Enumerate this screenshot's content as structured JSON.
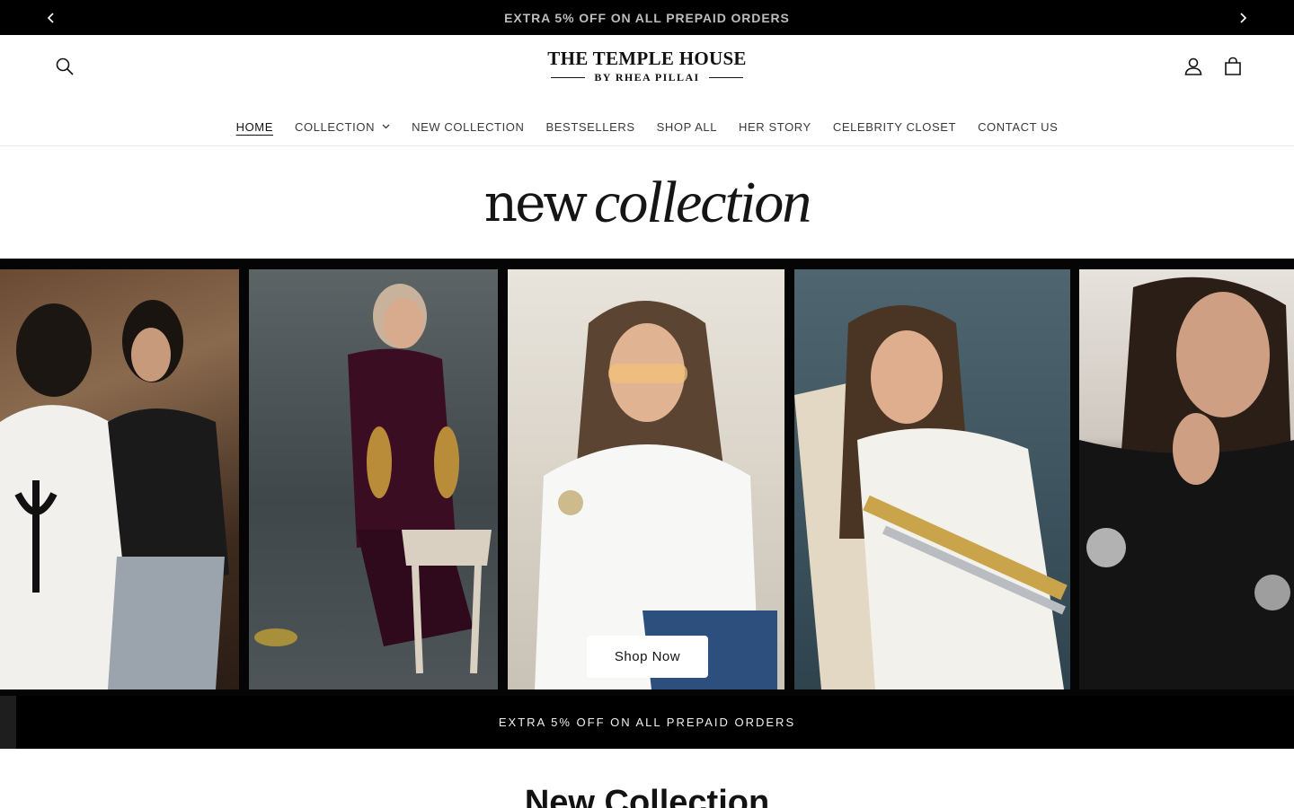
{
  "announcement": {
    "message": "EXTRA 5% OFF ON ALL PREPAID ORDERS",
    "prev_icon": "chevron-left-icon",
    "next_icon": "chevron-right-icon"
  },
  "header": {
    "logo_line1": "THE TEMPLE HOUSE",
    "logo_line2": "BY RHEA PILLAI",
    "search_icon": "search-icon",
    "account_icon": "account-icon",
    "cart_icon": "cart-icon"
  },
  "nav": {
    "items": [
      {
        "label": "HOME",
        "active": true
      },
      {
        "label": "COLLECTION",
        "dropdown": true
      },
      {
        "label": "NEW COLLECTION"
      },
      {
        "label": "BESTSELLERS"
      },
      {
        "label": "SHOP ALL"
      },
      {
        "label": "HER STORY"
      },
      {
        "label": "CELEBRITY CLOSET"
      },
      {
        "label": "CONTACT US"
      }
    ]
  },
  "hero": {
    "title_word1": "new",
    "title_word2": "collection",
    "shop_button": "Shop Now"
  },
  "strip": {
    "message": "EXTRA 5% OFF ON ALL PREPAID ORDERS"
  },
  "section": {
    "heading": "New Collection"
  }
}
